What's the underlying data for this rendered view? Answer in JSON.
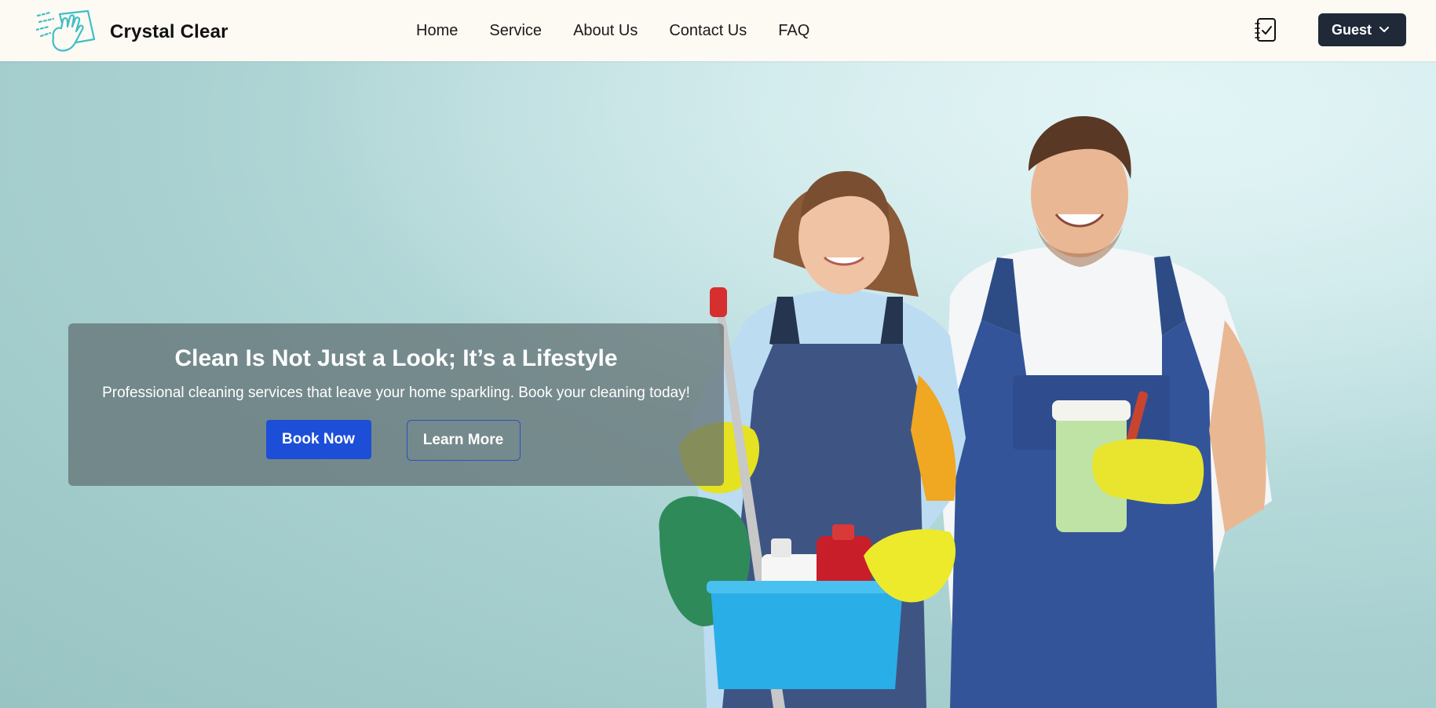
{
  "brand": {
    "name": "Crystal Clear",
    "logo_icon": "hand-wiping-cloth-icon",
    "accent_color": "#3fbfc6"
  },
  "nav": {
    "links": [
      "Home",
      "Service",
      "About Us",
      "Contact Us",
      "FAQ"
    ]
  },
  "header_actions": {
    "booking_icon": "checklist-notebook-icon",
    "user_menu_label": "Guest",
    "user_menu_icon": "chevron-down-icon"
  },
  "hero": {
    "title": "Clean Is Not Just a Look; It’s a Lifestyle",
    "subtitle": "Professional cleaning services that leave your home sparkling. Book your cleaning today!",
    "primary_button": "Book Now",
    "secondary_button": "Learn More",
    "image_subject": "two-cleaners-with-supplies-photo"
  },
  "colors": {
    "navbar_bg": "#fdf9f3",
    "user_button_bg": "#1f2937",
    "primary_button_bg": "#1d4ed8",
    "hero_bg": "#a9d0d0"
  }
}
